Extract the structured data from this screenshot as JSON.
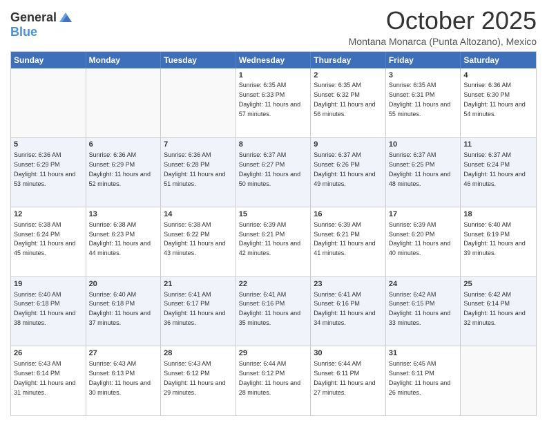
{
  "logo": {
    "general": "General",
    "blue": "Blue"
  },
  "title": "October 2025",
  "location": "Montana Monarca (Punta Altozano), Mexico",
  "days": [
    "Sunday",
    "Monday",
    "Tuesday",
    "Wednesday",
    "Thursday",
    "Friday",
    "Saturday"
  ],
  "weeks": [
    [
      {
        "day": "",
        "sunrise": "",
        "sunset": "",
        "daylight": "",
        "empty": true
      },
      {
        "day": "",
        "sunrise": "",
        "sunset": "",
        "daylight": "",
        "empty": true
      },
      {
        "day": "",
        "sunrise": "",
        "sunset": "",
        "daylight": "",
        "empty": true
      },
      {
        "day": "1",
        "sunrise": "Sunrise: 6:35 AM",
        "sunset": "Sunset: 6:33 PM",
        "daylight": "Daylight: 11 hours and 57 minutes."
      },
      {
        "day": "2",
        "sunrise": "Sunrise: 6:35 AM",
        "sunset": "Sunset: 6:32 PM",
        "daylight": "Daylight: 11 hours and 56 minutes."
      },
      {
        "day": "3",
        "sunrise": "Sunrise: 6:35 AM",
        "sunset": "Sunset: 6:31 PM",
        "daylight": "Daylight: 11 hours and 55 minutes."
      },
      {
        "day": "4",
        "sunrise": "Sunrise: 6:36 AM",
        "sunset": "Sunset: 6:30 PM",
        "daylight": "Daylight: 11 hours and 54 minutes."
      }
    ],
    [
      {
        "day": "5",
        "sunrise": "Sunrise: 6:36 AM",
        "sunset": "Sunset: 6:29 PM",
        "daylight": "Daylight: 11 hours and 53 minutes."
      },
      {
        "day": "6",
        "sunrise": "Sunrise: 6:36 AM",
        "sunset": "Sunset: 6:29 PM",
        "daylight": "Daylight: 11 hours and 52 minutes."
      },
      {
        "day": "7",
        "sunrise": "Sunrise: 6:36 AM",
        "sunset": "Sunset: 6:28 PM",
        "daylight": "Daylight: 11 hours and 51 minutes."
      },
      {
        "day": "8",
        "sunrise": "Sunrise: 6:37 AM",
        "sunset": "Sunset: 6:27 PM",
        "daylight": "Daylight: 11 hours and 50 minutes."
      },
      {
        "day": "9",
        "sunrise": "Sunrise: 6:37 AM",
        "sunset": "Sunset: 6:26 PM",
        "daylight": "Daylight: 11 hours and 49 minutes."
      },
      {
        "day": "10",
        "sunrise": "Sunrise: 6:37 AM",
        "sunset": "Sunset: 6:25 PM",
        "daylight": "Daylight: 11 hours and 48 minutes."
      },
      {
        "day": "11",
        "sunrise": "Sunrise: 6:37 AM",
        "sunset": "Sunset: 6:24 PM",
        "daylight": "Daylight: 11 hours and 46 minutes."
      }
    ],
    [
      {
        "day": "12",
        "sunrise": "Sunrise: 6:38 AM",
        "sunset": "Sunset: 6:24 PM",
        "daylight": "Daylight: 11 hours and 45 minutes."
      },
      {
        "day": "13",
        "sunrise": "Sunrise: 6:38 AM",
        "sunset": "Sunset: 6:23 PM",
        "daylight": "Daylight: 11 hours and 44 minutes."
      },
      {
        "day": "14",
        "sunrise": "Sunrise: 6:38 AM",
        "sunset": "Sunset: 6:22 PM",
        "daylight": "Daylight: 11 hours and 43 minutes."
      },
      {
        "day": "15",
        "sunrise": "Sunrise: 6:39 AM",
        "sunset": "Sunset: 6:21 PM",
        "daylight": "Daylight: 11 hours and 42 minutes."
      },
      {
        "day": "16",
        "sunrise": "Sunrise: 6:39 AM",
        "sunset": "Sunset: 6:21 PM",
        "daylight": "Daylight: 11 hours and 41 minutes."
      },
      {
        "day": "17",
        "sunrise": "Sunrise: 6:39 AM",
        "sunset": "Sunset: 6:20 PM",
        "daylight": "Daylight: 11 hours and 40 minutes."
      },
      {
        "day": "18",
        "sunrise": "Sunrise: 6:40 AM",
        "sunset": "Sunset: 6:19 PM",
        "daylight": "Daylight: 11 hours and 39 minutes."
      }
    ],
    [
      {
        "day": "19",
        "sunrise": "Sunrise: 6:40 AM",
        "sunset": "Sunset: 6:18 PM",
        "daylight": "Daylight: 11 hours and 38 minutes."
      },
      {
        "day": "20",
        "sunrise": "Sunrise: 6:40 AM",
        "sunset": "Sunset: 6:18 PM",
        "daylight": "Daylight: 11 hours and 37 minutes."
      },
      {
        "day": "21",
        "sunrise": "Sunrise: 6:41 AM",
        "sunset": "Sunset: 6:17 PM",
        "daylight": "Daylight: 11 hours and 36 minutes."
      },
      {
        "day": "22",
        "sunrise": "Sunrise: 6:41 AM",
        "sunset": "Sunset: 6:16 PM",
        "daylight": "Daylight: 11 hours and 35 minutes."
      },
      {
        "day": "23",
        "sunrise": "Sunrise: 6:41 AM",
        "sunset": "Sunset: 6:16 PM",
        "daylight": "Daylight: 11 hours and 34 minutes."
      },
      {
        "day": "24",
        "sunrise": "Sunrise: 6:42 AM",
        "sunset": "Sunset: 6:15 PM",
        "daylight": "Daylight: 11 hours and 33 minutes."
      },
      {
        "day": "25",
        "sunrise": "Sunrise: 6:42 AM",
        "sunset": "Sunset: 6:14 PM",
        "daylight": "Daylight: 11 hours and 32 minutes."
      }
    ],
    [
      {
        "day": "26",
        "sunrise": "Sunrise: 6:43 AM",
        "sunset": "Sunset: 6:14 PM",
        "daylight": "Daylight: 11 hours and 31 minutes."
      },
      {
        "day": "27",
        "sunrise": "Sunrise: 6:43 AM",
        "sunset": "Sunset: 6:13 PM",
        "daylight": "Daylight: 11 hours and 30 minutes."
      },
      {
        "day": "28",
        "sunrise": "Sunrise: 6:43 AM",
        "sunset": "Sunset: 6:12 PM",
        "daylight": "Daylight: 11 hours and 29 minutes."
      },
      {
        "day": "29",
        "sunrise": "Sunrise: 6:44 AM",
        "sunset": "Sunset: 6:12 PM",
        "daylight": "Daylight: 11 hours and 28 minutes."
      },
      {
        "day": "30",
        "sunrise": "Sunrise: 6:44 AM",
        "sunset": "Sunset: 6:11 PM",
        "daylight": "Daylight: 11 hours and 27 minutes."
      },
      {
        "day": "31",
        "sunrise": "Sunrise: 6:45 AM",
        "sunset": "Sunset: 6:11 PM",
        "daylight": "Daylight: 11 hours and 26 minutes."
      },
      {
        "day": "",
        "sunrise": "",
        "sunset": "",
        "daylight": "",
        "empty": true
      }
    ]
  ]
}
